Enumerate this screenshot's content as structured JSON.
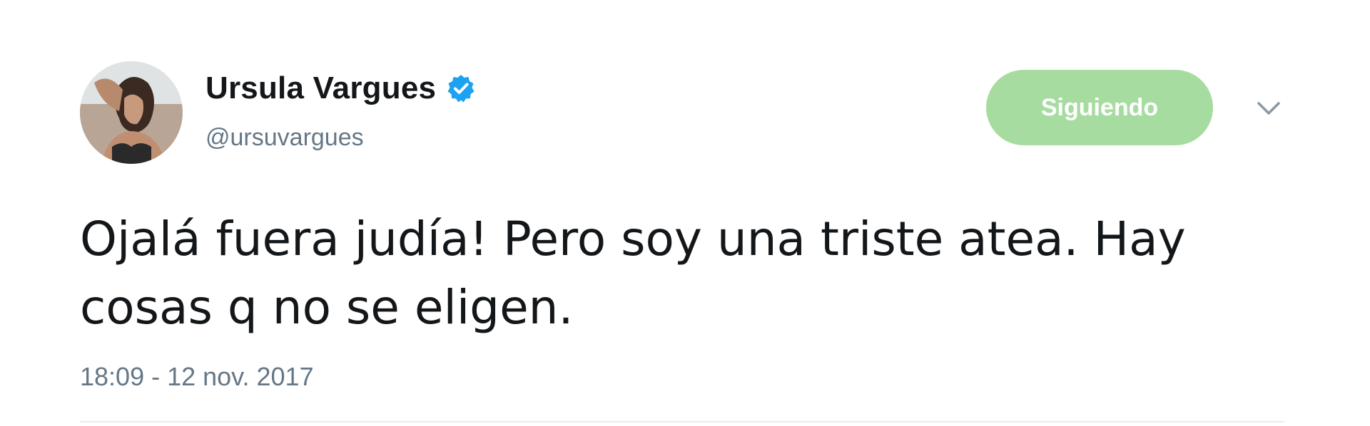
{
  "author": {
    "display_name": "Ursula Vargues",
    "handle": "@ursuvargues",
    "verified": true,
    "avatar": "profile-photo"
  },
  "follow_button": {
    "label": "Siguiendo",
    "color": "#a7dca0"
  },
  "menu": {
    "icon": "chevron-down-icon"
  },
  "tweet": {
    "text": "Ojalá fuera judía! Pero soy una triste atea. Hay cosas q no se eligen.",
    "timestamp": "18:09 - 12 nov. 2017"
  },
  "colors": {
    "verified": "#1da1f2",
    "text": "#14171a",
    "muted": "#657786"
  }
}
